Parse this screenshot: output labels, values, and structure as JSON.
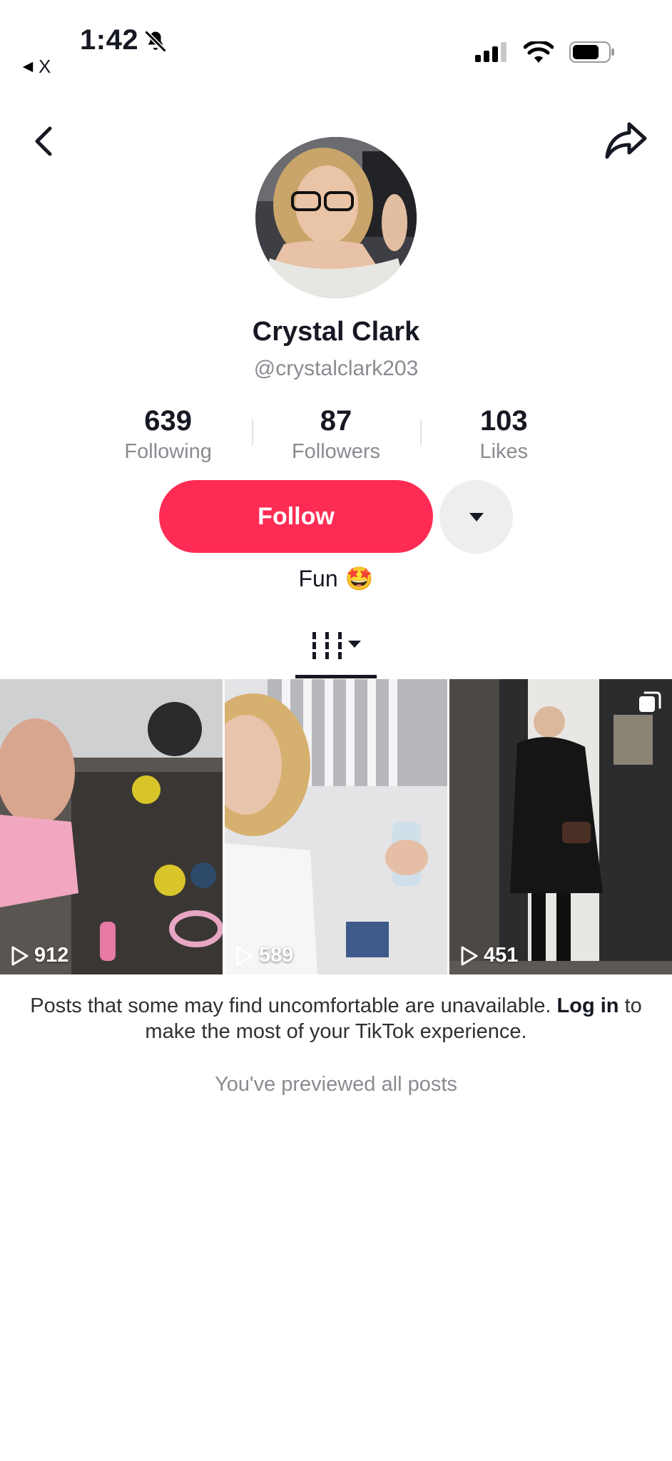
{
  "status_bar": {
    "time": "1:42",
    "back_app": "X"
  },
  "profile": {
    "display_name": "Crystal Clark",
    "username": "@crystalclark203",
    "stats": [
      {
        "value": "639",
        "label": "Following"
      },
      {
        "value": "87",
        "label": "Followers"
      },
      {
        "value": "103",
        "label": "Likes"
      }
    ],
    "follow_label": "Follow",
    "bio": "Fun",
    "bio_emoji": "🤩"
  },
  "posts": [
    {
      "views": "912",
      "multi": false
    },
    {
      "views": "589",
      "multi": false
    },
    {
      "views": "451",
      "multi": true
    }
  ],
  "notice": {
    "before": "Posts that some may find uncomfortable are unavailable.",
    "login": "Log in",
    "after": "to make the most of your TikTok experience."
  },
  "previewed_text": "You've previewed all posts",
  "colors": {
    "accent": "#fe2c55",
    "text": "#161823",
    "muted": "#8a8b91"
  },
  "icons": [
    "bell-slash-icon",
    "back-arrow-icon",
    "share-icon",
    "cellular-icon",
    "wifi-icon",
    "battery-icon",
    "chevron-down-icon",
    "grid-tab-icon",
    "play-icon",
    "multi-post-icon"
  ]
}
